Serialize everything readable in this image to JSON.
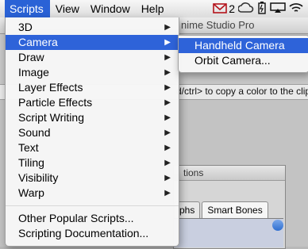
{
  "menubar": {
    "items": [
      "Scripts",
      "View",
      "Window",
      "Help"
    ],
    "active": "Scripts",
    "tray_count": "2",
    "icons": [
      "mail-icon",
      "creative-cloud-icon",
      "battery-icon",
      "airplay-icon",
      "wifi-icon"
    ]
  },
  "background": {
    "title": "nime Studio Pro",
    "hint": "d/ctrl> to copy a color to the clip",
    "panel_title": "tions",
    "tabs": [
      "phs",
      "Smart Bones"
    ]
  },
  "menu": {
    "items": [
      {
        "label": "3D"
      },
      {
        "label": "Camera"
      },
      {
        "label": "Draw"
      },
      {
        "label": "Image"
      },
      {
        "label": "Layer Effects"
      },
      {
        "label": "Particle Effects"
      },
      {
        "label": "Script Writing"
      },
      {
        "label": "Sound"
      },
      {
        "label": "Text"
      },
      {
        "label": "Tiling"
      },
      {
        "label": "Visibility"
      },
      {
        "label": "Warp"
      }
    ],
    "extra": [
      "Other Popular Scripts...",
      "Scripting Documentation..."
    ],
    "highlighted": "Camera"
  },
  "submenu": {
    "items": [
      "Handheld Camera",
      "Orbit Camera..."
    ],
    "highlighted": "Handheld Camera"
  },
  "colors": {
    "highlight": "#2e63d9"
  }
}
